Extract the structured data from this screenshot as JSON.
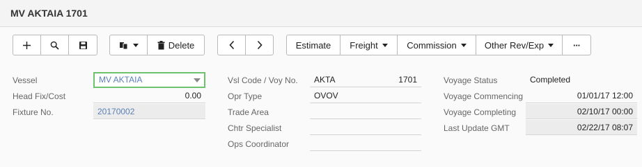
{
  "header": {
    "title": "MV AKTAIA 1701"
  },
  "toolbar": {
    "delete_label": "Delete",
    "estimate_label": "Estimate",
    "freight_label": "Freight",
    "commission_label": "Commission",
    "other_label": "Other Rev/Exp",
    "more_label": "···"
  },
  "col1": {
    "vessel_label": "Vessel",
    "vessel_value": "MV AKTAIA",
    "headfix_label": "Head Fix/Cost",
    "headfix_value": "0.00",
    "fixture_label": "Fixture No.",
    "fixture_value": "20170002"
  },
  "col2": {
    "vslcode_label": "Vsl Code / Voy No.",
    "vslcode_value": "AKTA",
    "voyno_value": "1701",
    "oprtype_label": "Opr Type",
    "oprtype_value": "OVOV",
    "tradearea_label": "Trade Area",
    "tradearea_value": "",
    "chtr_label": "Chtr Specialist",
    "chtr_value": "",
    "ops_label": "Ops Coordinator",
    "ops_value": ""
  },
  "col3": {
    "status_label": "Voyage Status",
    "status_value": "Completed",
    "commencing_label": "Voyage Commencing",
    "commencing_value": "01/01/17 12:00",
    "completing_label": "Voyage Completing",
    "completing_value": "02/10/17 00:00",
    "lastupdate_label": "Last Update GMT",
    "lastupdate_value": "02/22/17 08:07"
  },
  "colors": {
    "vessel_border": "#6cc36c",
    "link": "#5b7fb8"
  }
}
